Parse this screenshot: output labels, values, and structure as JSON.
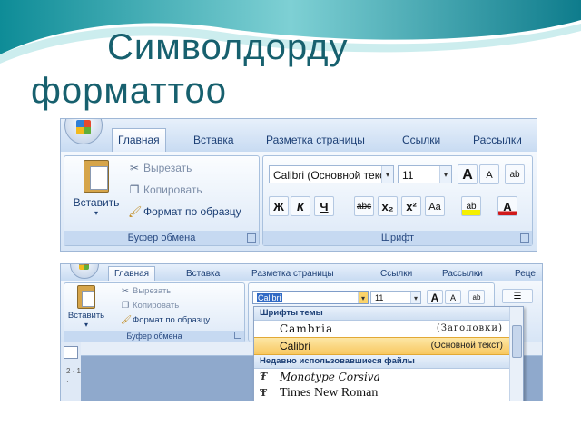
{
  "slide": {
    "title_line1": "Символдорду",
    "title_line2": "форматтоо",
    "accent_color": "#17606e"
  },
  "ribbon1": {
    "tabs": [
      "Главная",
      "Вставка",
      "Разметка страницы",
      "Ссылки",
      "Рассылки"
    ],
    "active_tab": "Главная",
    "clipboard": {
      "paste_label": "Вставить",
      "paste_arrow": "▾",
      "cut": "Вырезать",
      "copy": "Копировать",
      "format_painter": "Формат по образцу",
      "group_label": "Буфер обмена"
    },
    "font": {
      "font_name": "Calibri (Основной текст)",
      "font_size": "11",
      "group_label": "Шрифт",
      "buttons": {
        "grow": "A",
        "shrink": "A",
        "clear": "ab",
        "bold": "Ж",
        "italic": "К",
        "underline": "Ч",
        "strike": "abc",
        "subscript": "x₂",
        "superscript": "x²",
        "case": "Aa",
        "highlight": "ab",
        "font_color": "A"
      }
    }
  },
  "ribbon2": {
    "tabs": [
      "Главная",
      "Вставка",
      "Разметка страницы",
      "Ссылки",
      "Рассылки",
      "Реце"
    ],
    "active_tab": "Главная",
    "clipboard": {
      "paste_label": "Вставить",
      "paste_arrow": "▾",
      "cut": "Вырезать",
      "copy": "Копировать",
      "format_painter": "Формат по образцу",
      "group_label": "Буфер обмена"
    },
    "font": {
      "font_name": "Calibri",
      "font_size": "11"
    },
    "dropdown": {
      "theme_header": "Шрифты темы",
      "theme_fonts": [
        {
          "name": "Cambria",
          "tag": "(Заголовки)",
          "selected": false
        },
        {
          "name": "Calibri",
          "tag": "(Основной текст)",
          "selected": true
        }
      ],
      "recent_header": "Недавно использовавшиеся файлы",
      "recent_fonts": [
        {
          "name": "Monotype Corsiva"
        },
        {
          "name": "Times New Roman"
        }
      ]
    },
    "ruler_marks": "2 · 1 ·"
  }
}
